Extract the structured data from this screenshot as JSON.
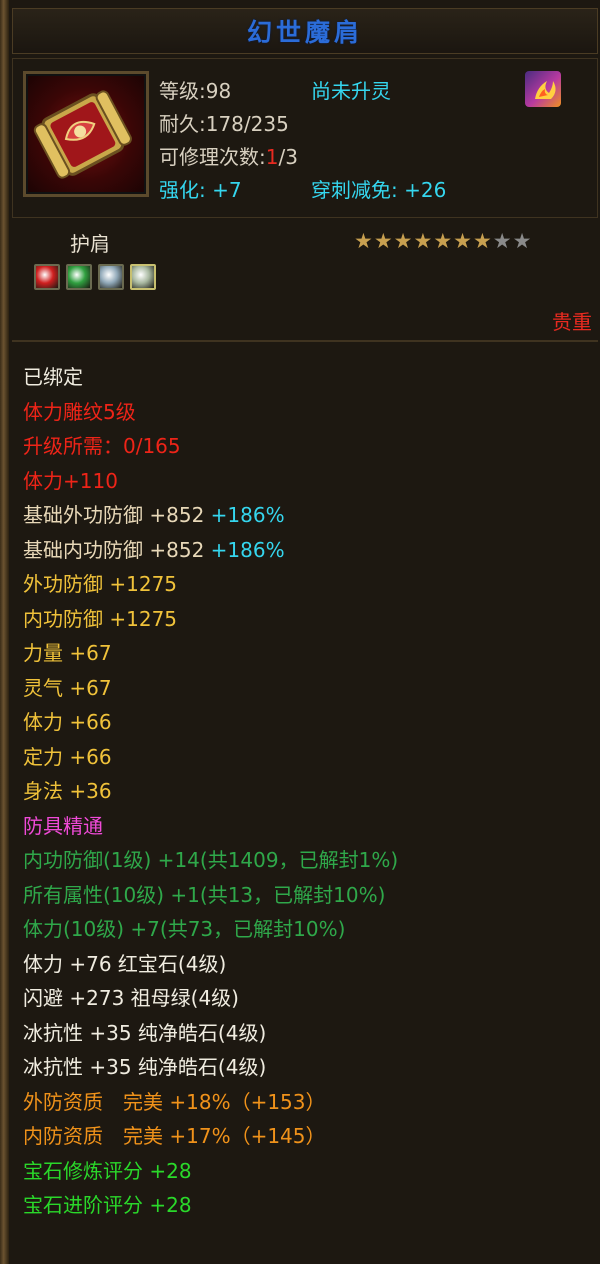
{
  "title": "幻世魔肩",
  "header": {
    "level": "等级:98",
    "spirit_status": "尚未升灵",
    "durability": "耐久:178/235",
    "repair_label": "可修理次数:",
    "repair_used": "1",
    "repair_total": "/3",
    "enhance": "强化: +7",
    "pierce_reduce": "穿刺减免: +26",
    "item_icon": "scroll-shoulder-icon",
    "spirit_icon": "spirit-flame-icon"
  },
  "slot_type": "护肩",
  "stars": {
    "filled": 7,
    "total": 9
  },
  "gems": [
    {
      "name": "ruby-gem-icon",
      "color": "#d02020"
    },
    {
      "name": "emerald-gem-icon",
      "color": "#30a040"
    },
    {
      "name": "diamond-gem-icon",
      "color": "#90a8b8"
    },
    {
      "name": "diamond-gem-icon",
      "color": "#a8b8a0"
    }
  ],
  "quality": "贵重",
  "stats": [
    {
      "text": "已绑定",
      "color": "white"
    },
    {
      "text": "体力雕纹5级",
      "color": "red"
    },
    {
      "text": "升级所需：0/165",
      "color": "red"
    },
    {
      "text": "体力+110",
      "color": "red"
    },
    {
      "text": "基础外功防御 +852",
      "extra": "+186%",
      "color": "beige"
    },
    {
      "text": "基础内功防御 +852",
      "extra": "+186%",
      "color": "beige"
    },
    {
      "text": "外功防御 +1275",
      "color": "yellow"
    },
    {
      "text": "内功防御 +1275",
      "color": "yellow"
    },
    {
      "text": "力量 +67",
      "color": "yellow"
    },
    {
      "text": "灵气 +67",
      "color": "yellow"
    },
    {
      "text": "体力 +66",
      "color": "yellow"
    },
    {
      "text": "定力 +66",
      "color": "yellow"
    },
    {
      "text": "身法 +36",
      "color": "yellow"
    },
    {
      "text": "防具精通",
      "color": "pink"
    },
    {
      "text": "内功防御(1级) +14(共1409，已解封1%)",
      "color": "green"
    },
    {
      "text": "所有属性(10级) +1(共13，已解封10%)",
      "color": "green"
    },
    {
      "text": "体力(10级) +7(共73，已解封10%)",
      "color": "green"
    },
    {
      "text": "体力 +76 红宝石(4级)",
      "color": "white"
    },
    {
      "text": "闪避 +273 祖母绿(4级)",
      "color": "white"
    },
    {
      "text": "冰抗性 +35 纯净皓石(4级)",
      "color": "white"
    },
    {
      "text": "冰抗性 +35 纯净皓石(4级)",
      "color": "white"
    },
    {
      "text": "外防资质　完美 +18%（+153）",
      "color": "orange"
    },
    {
      "text": "内防资质　完美 +17%（+145）",
      "color": "orange"
    },
    {
      "text": "宝石修炼评分 +28",
      "color": "bright"
    },
    {
      "text": "宝石进阶评分 +28",
      "color": "bright"
    }
  ]
}
